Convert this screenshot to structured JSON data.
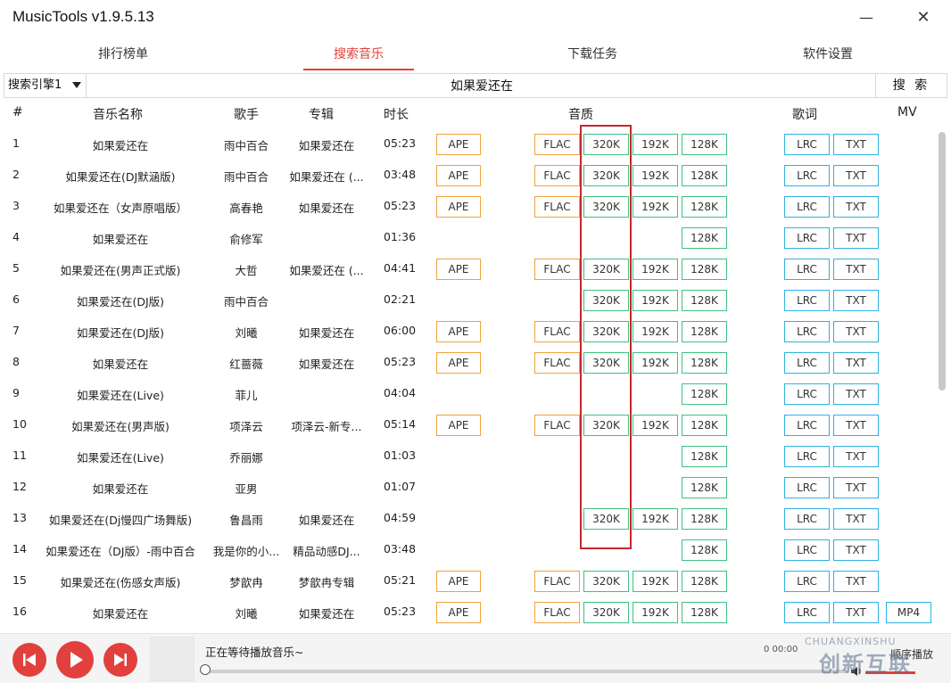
{
  "app": {
    "title": "MusicTools v1.9.5.13",
    "minimize_glyph": "—",
    "close_glyph": "✕"
  },
  "tabs": [
    {
      "label": "排行榜单",
      "active": false
    },
    {
      "label": "搜索音乐",
      "active": true
    },
    {
      "label": "下载任务",
      "active": false
    },
    {
      "label": "软件设置",
      "active": false
    }
  ],
  "search": {
    "engine": "搜索引擎1",
    "query": "如果爱还在",
    "button": "搜 索"
  },
  "columns": {
    "num": "#",
    "name": "音乐名称",
    "artist": "歌手",
    "album": "专辑",
    "duration": "时长",
    "quality": "音质",
    "lyrics": "歌词",
    "mv": "MV"
  },
  "quality_labels": {
    "ape": "APE",
    "flac": "FLAC",
    "k320": "320K",
    "k192": "192K",
    "k128": "128K",
    "lrc": "LRC",
    "txt": "TXT",
    "mp4": "MP4"
  },
  "rows": [
    {
      "num": "1",
      "name": "如果爱还在",
      "artist": "雨中百合",
      "album": "如果爱还在",
      "duration": "05:23",
      "q": [
        "ape",
        "flac",
        "k320",
        "k192",
        "k128"
      ],
      "mp4": false
    },
    {
      "num": "2",
      "name": "如果爱还在(DJ默涵版)",
      "artist": "雨中百合",
      "album": "如果爱还在 (...",
      "duration": "03:48",
      "q": [
        "ape",
        "flac",
        "k320",
        "k192",
        "k128"
      ],
      "mp4": false
    },
    {
      "num": "3",
      "name": "如果爱还在（女声原唱版）",
      "artist": "高春艳",
      "album": "如果爱还在",
      "duration": "05:23",
      "q": [
        "ape",
        "flac",
        "k320",
        "k192",
        "k128"
      ],
      "mp4": false
    },
    {
      "num": "4",
      "name": "如果爱还在",
      "artist": "俞修军",
      "album": "",
      "duration": "01:36",
      "q": [
        "k128"
      ],
      "mp4": false
    },
    {
      "num": "5",
      "name": "如果爱还在(男声正式版)",
      "artist": "大哲",
      "album": "如果爱还在 (...",
      "duration": "04:41",
      "q": [
        "ape",
        "flac",
        "k320",
        "k192",
        "k128"
      ],
      "mp4": false
    },
    {
      "num": "6",
      "name": "如果爱还在(DJ版)",
      "artist": "雨中百合",
      "album": "",
      "duration": "02:21",
      "q": [
        "k320",
        "k192",
        "k128"
      ],
      "mp4": false
    },
    {
      "num": "7",
      "name": "如果爱还在(DJ版)",
      "artist": "刘曦",
      "album": "如果爱还在",
      "duration": "06:00",
      "q": [
        "ape",
        "flac",
        "k320",
        "k192",
        "k128"
      ],
      "mp4": false
    },
    {
      "num": "8",
      "name": "如果爱还在",
      "artist": "红蔷薇",
      "album": "如果爱还在",
      "duration": "05:23",
      "q": [
        "ape",
        "flac",
        "k320",
        "k192",
        "k128"
      ],
      "mp4": false
    },
    {
      "num": "9",
      "name": "如果爱还在(Live)",
      "artist": "菲儿",
      "album": "",
      "duration": "04:04",
      "q": [
        "k128"
      ],
      "mp4": false
    },
    {
      "num": "10",
      "name": "如果爱还在(男声版)",
      "artist": "项泽云",
      "album": "项泽云-新专...",
      "duration": "05:14",
      "q": [
        "ape",
        "flac",
        "k320",
        "k192",
        "k128"
      ],
      "mp4": false
    },
    {
      "num": "11",
      "name": "如果爱还在(Live)",
      "artist": "乔丽娜",
      "album": "",
      "duration": "01:03",
      "q": [
        "k128"
      ],
      "mp4": false
    },
    {
      "num": "12",
      "name": "如果爱还在",
      "artist": "亚男",
      "album": "",
      "duration": "01:07",
      "q": [
        "k128"
      ],
      "mp4": false
    },
    {
      "num": "13",
      "name": "如果爱还在(Dj慢四广场舞版)",
      "artist": "鲁昌雨",
      "album": "如果爱还在",
      "duration": "04:59",
      "q": [
        "k320",
        "k192",
        "k128"
      ],
      "mp4": false
    },
    {
      "num": "14",
      "name": "如果爱还在（DJ版）-雨中百合",
      "artist": "我是你的小...",
      "album": "精品动感DJ...",
      "duration": "03:48",
      "q": [
        "k128"
      ],
      "mp4": false
    },
    {
      "num": "15",
      "name": "如果爱还在(伤感女声版)",
      "artist": "梦歆冉",
      "album": "梦歆冉专辑",
      "duration": "05:21",
      "q": [
        "ape",
        "flac",
        "k320",
        "k192",
        "k128"
      ],
      "mp4": false
    },
    {
      "num": "16",
      "name": "如果爱还在",
      "artist": "刘曦",
      "album": "如果爱还在",
      "duration": "05:23",
      "q": [
        "ape",
        "flac",
        "k320",
        "k192",
        "k128"
      ],
      "mp4": true
    }
  ],
  "player": {
    "status": "正在等待播放音乐~",
    "time": "0 00:00",
    "mode": "顺序播放",
    "prev_icon": "skip-previous-icon",
    "play_icon": "play-icon",
    "next_icon": "skip-next-icon",
    "progress_fraction": 0
  },
  "watermark": {
    "top": "CHUANGXINSHU",
    "main": "创新互联"
  },
  "colors": {
    "accent": "#e2403c",
    "ape_flac": "#f1a23a",
    "kbps": "#3fbf82",
    "lyrics": "#2eb1e0",
    "highlight": "#c8262c"
  }
}
